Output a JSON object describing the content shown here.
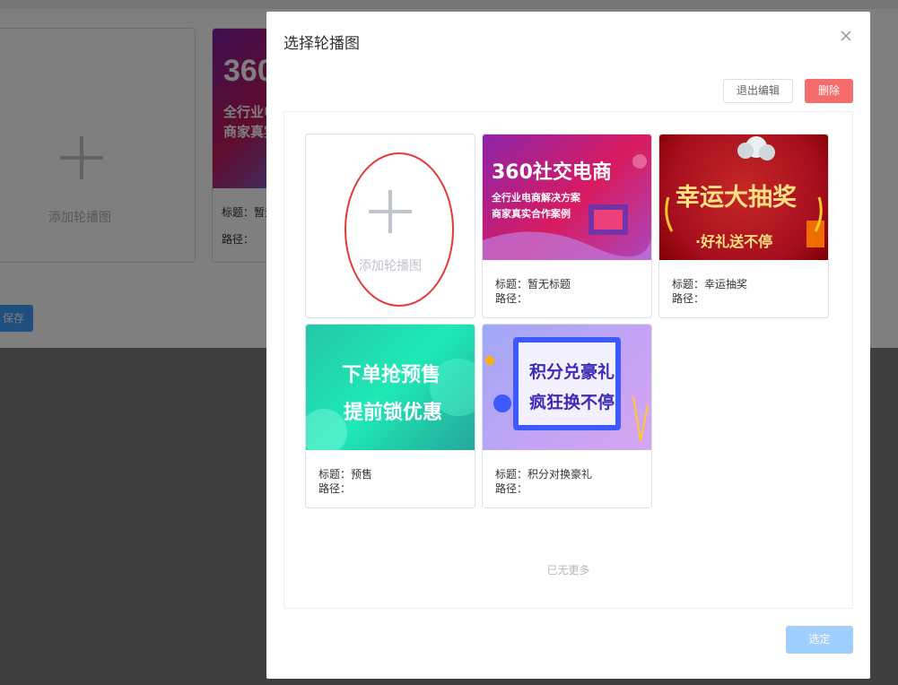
{
  "background": {
    "add_label": "添加轮播图",
    "card_banner_line1": "360",
    "card_banner_line2": "全行业电",
    "card_banner_line3": "商家真实",
    "card_title": "标题：暂无",
    "card_path": "路径：",
    "save_label": "保存"
  },
  "dialog": {
    "title": "选择轮播图",
    "exit_edit_label": "退出编辑",
    "delete_label": "删除",
    "add_label": "添加轮播图",
    "no_more_label": "已无更多",
    "confirm_label": "选定",
    "cards": [
      {
        "title": "标题：暂无标题",
        "path": "路径：",
        "banner": {
          "line1": "360社交电商",
          "line2": "全行业电商解决方案",
          "line3": "商家真实合作案例"
        }
      },
      {
        "title": "标题：幸运抽奖",
        "path": "路径：",
        "banner": {
          "line1": "幸运大抽奖",
          "line2": "·好礼送不停"
        }
      },
      {
        "title": "标题：预售",
        "path": "路径：",
        "banner": {
          "line1": "下单抢预售",
          "line2": "提前锁优惠"
        }
      },
      {
        "title": "标题：积分对换豪礼",
        "path": "路径：",
        "banner": {
          "line1": "积分兑豪礼",
          "line2": "疯狂换不停"
        }
      }
    ]
  },
  "colors": {
    "primary": "#409eff",
    "primary_disabled": "#a0cfff",
    "danger": "#f56c6c",
    "highlight_ring": "#e53935"
  }
}
